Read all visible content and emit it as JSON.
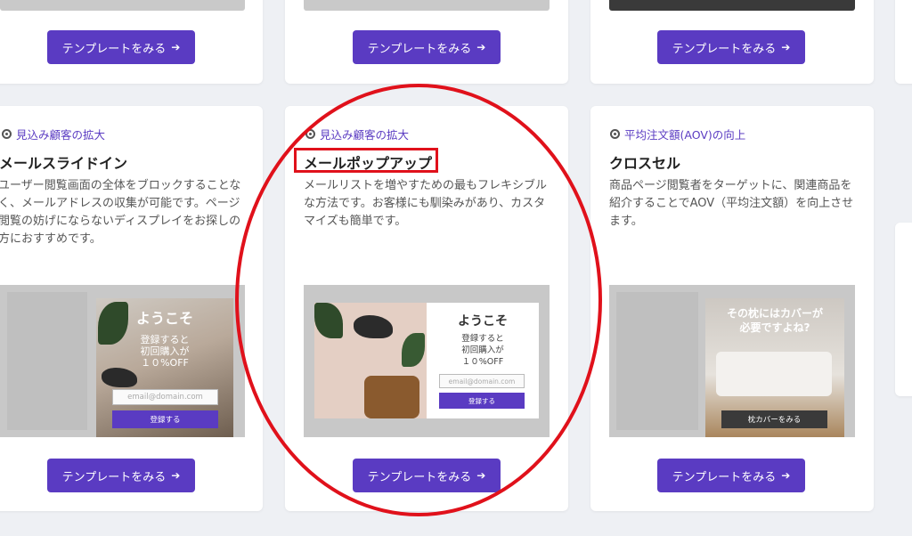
{
  "buttons": {
    "template_label": "テンプレートをみる",
    "arrow": "➔"
  },
  "cards": [
    {
      "tag": "見込み顧客の拡大",
      "title": "メールスライドイン",
      "description": "ユーザー閲覧画面の全体をブロックすることなく、メールアドレスの収集が可能です。ページ閲覧の妨げにならないディスプレイをお探しの方におすすめです。",
      "preview": {
        "heading": "ようこそ",
        "text": "登録すると\n初回購入が\n１０%OFF",
        "input_placeholder": "email@domain.com",
        "submit_label": "登録する"
      }
    },
    {
      "tag": "見込み顧客の拡大",
      "title": "メールポップアップ",
      "description": "メールリストを増やすための最もフレキシブルな方法です。お客様にも馴染みがあり、カスタマイズも簡単です。",
      "preview": {
        "heading": "ようこそ",
        "text": "登録すると\n初回購入が\n１０%OFF",
        "input_placeholder": "email@domain.com",
        "submit_label": "登録する"
      }
    },
    {
      "tag": "平均注文額(AOV)の向上",
      "title": "クロスセル",
      "description": "商品ページ閲覧者をターゲットに、関連商品を紹介することでAOV（平均注文額）を向上させます。",
      "preview": {
        "heading": "その枕にはカバーが\n必要ですよね?",
        "cta_label": "枕カバーをみる"
      }
    }
  ],
  "colors": {
    "accent": "#5a3bc2",
    "annotation": "#e0111b"
  }
}
